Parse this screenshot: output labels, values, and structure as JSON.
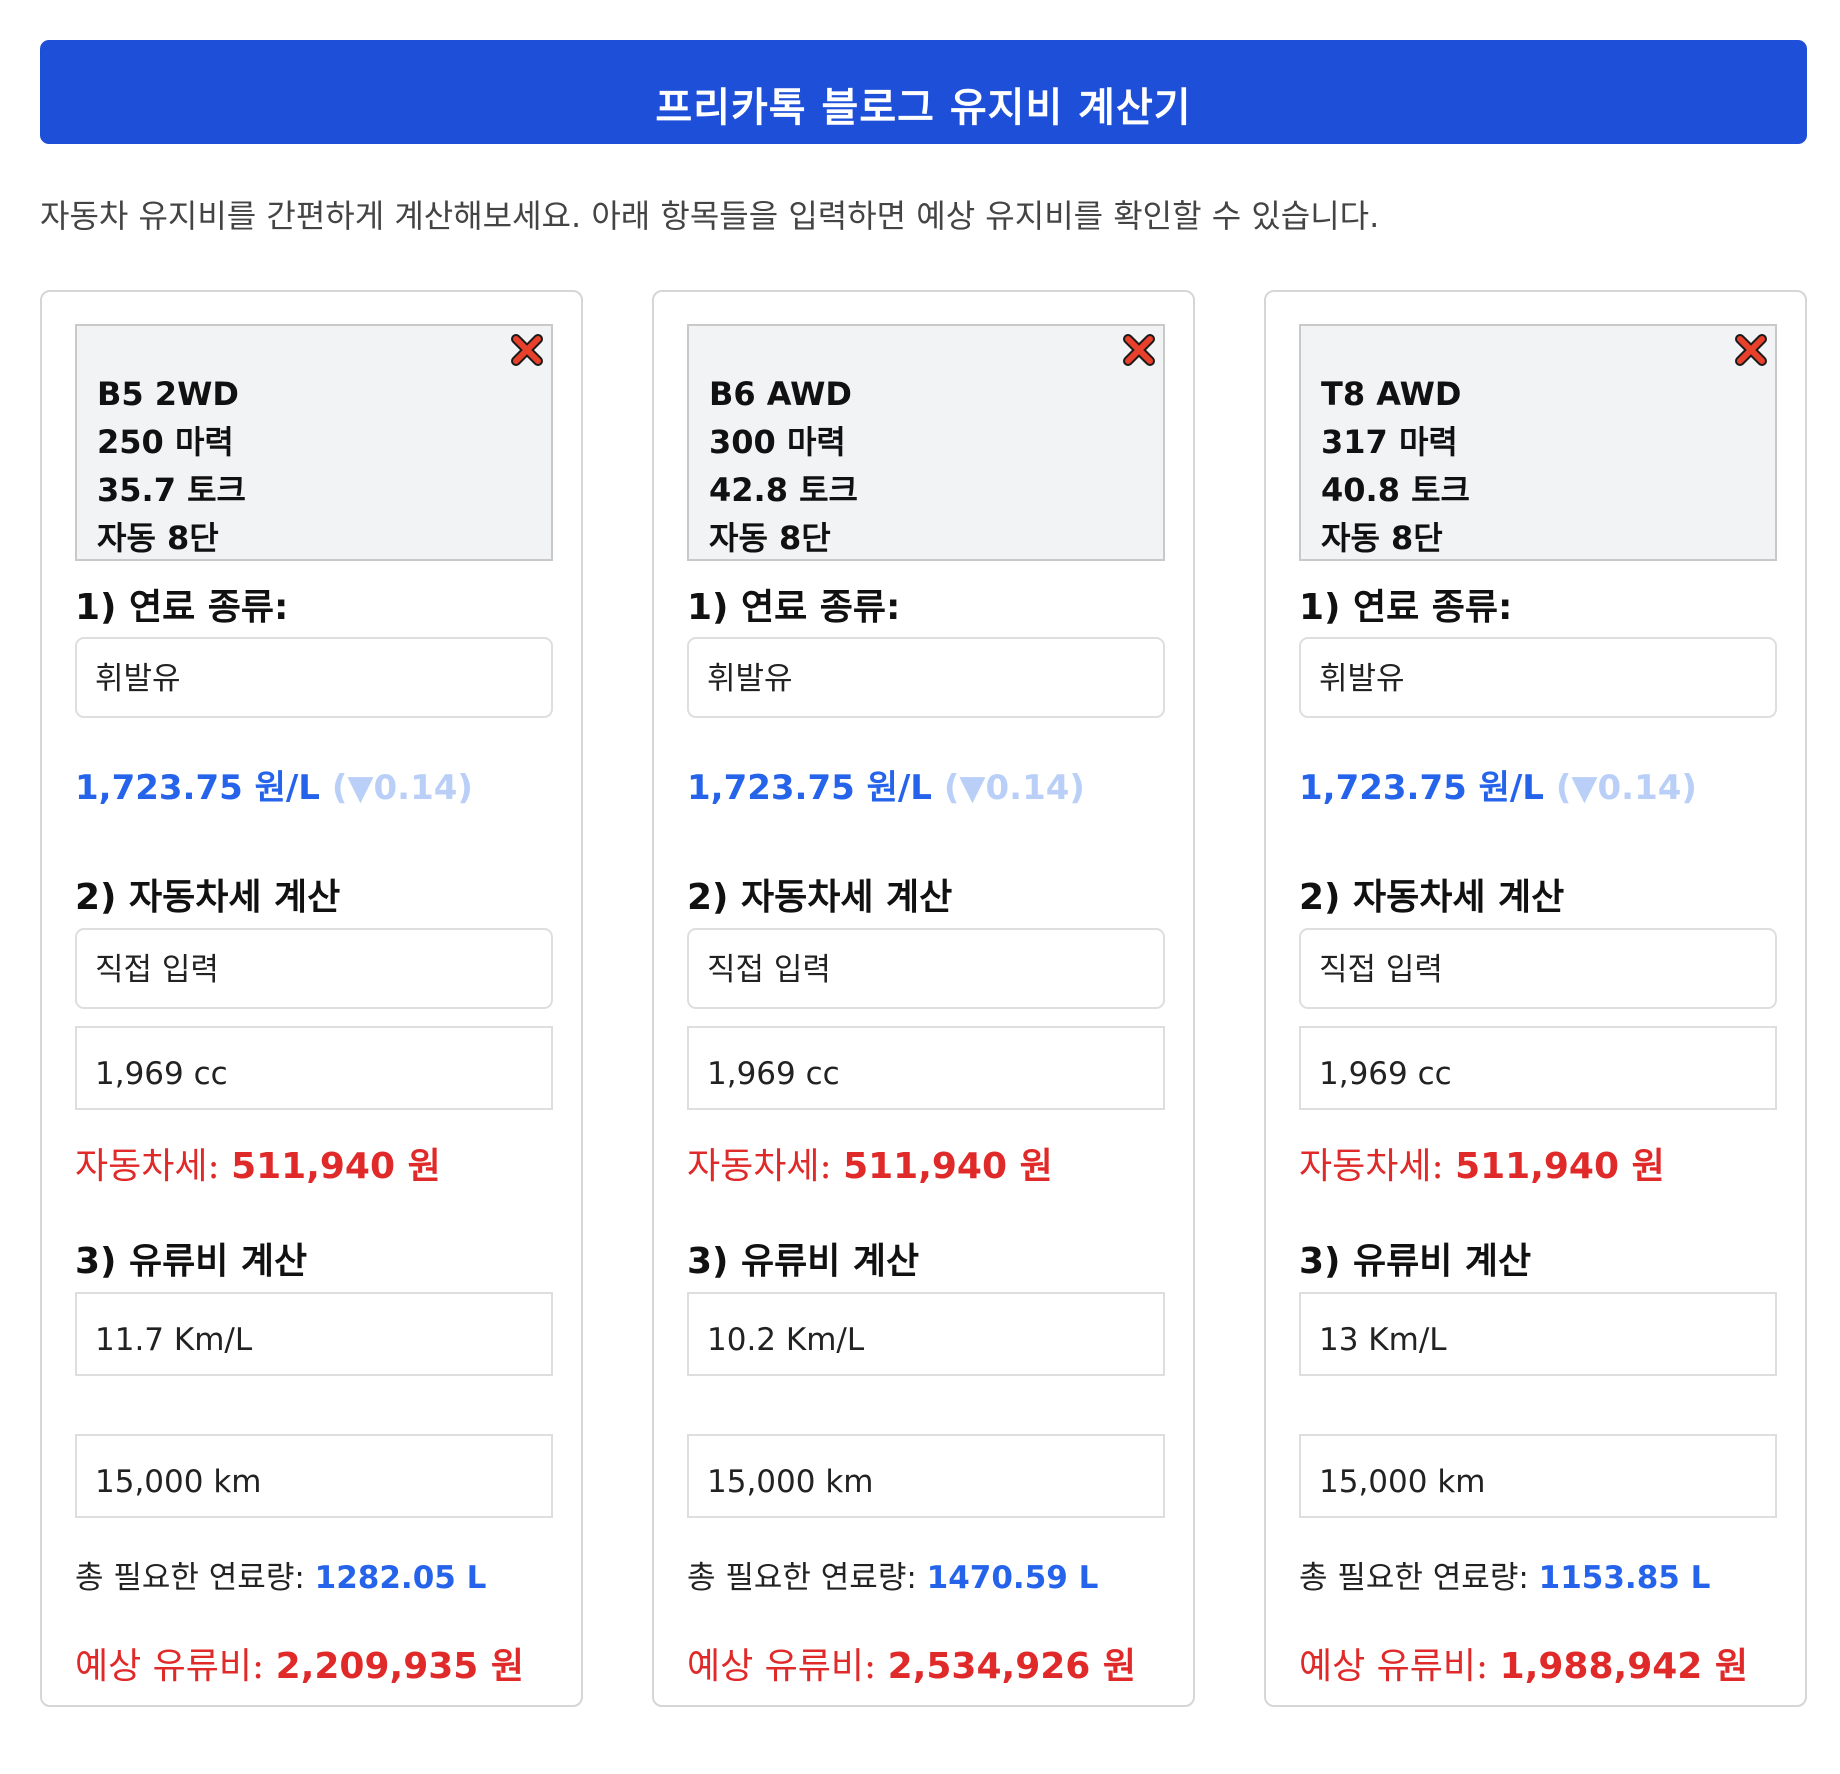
{
  "header": {
    "title": "프리카톡 블로그 유지비 계산기"
  },
  "intro": "자동차 유지비를 간편하게 계산해보세요. 아래 항목들을 입력하면 예상 유지비를 확인할 수 있습니다.",
  "colors": {
    "header": "#1e4fd8",
    "price": "#2563eb",
    "result": "#e02a2a",
    "close": "#e8402b"
  },
  "labels": {
    "fuel_type": "1) 연료 종류:",
    "car_tax": "2) 자동차세 계산",
    "fuel_cost": "3) 유류비 계산",
    "car_tax_result": "자동차세:",
    "total_fuel": "총 필요한 연료량:",
    "expected_fuel_cost": "예상 유류비:"
  },
  "cards": [
    {
      "info": [
        "B5 2WD",
        "250 마력",
        "35.7 토크",
        "자동 8단"
      ],
      "fuel_type": "휘발유",
      "price": "1,723.75 원/L",
      "price_delta": "(▼0.14)",
      "tax_mode": "직접 입력",
      "displacement": "1,969 cc",
      "car_tax": "511,940 원",
      "efficiency": "11.7 Km/L",
      "distance": "15,000 km",
      "total_fuel": "1282.05 L",
      "fuel_cost": "2,209,935 원"
    },
    {
      "info": [
        "B6 AWD",
        "300 마력",
        "42.8 토크",
        "자동 8단"
      ],
      "fuel_type": "휘발유",
      "price": "1,723.75 원/L",
      "price_delta": "(▼0.14)",
      "tax_mode": "직접 입력",
      "displacement": "1,969 cc",
      "car_tax": "511,940 원",
      "efficiency": "10.2 Km/L",
      "distance": "15,000 km",
      "total_fuel": "1470.59 L",
      "fuel_cost": "2,534,926 원"
    },
    {
      "info": [
        "T8 AWD",
        "317 마력",
        "40.8 토크",
        "자동 8단"
      ],
      "fuel_type": "휘발유",
      "price": "1,723.75 원/L",
      "price_delta": "(▼0.14)",
      "tax_mode": "직접 입력",
      "displacement": "1,969 cc",
      "car_tax": "511,940 원",
      "efficiency": "13 Km/L",
      "distance": "15,000 km",
      "total_fuel": "1153.85 L",
      "fuel_cost": "1,988,942 원"
    }
  ]
}
